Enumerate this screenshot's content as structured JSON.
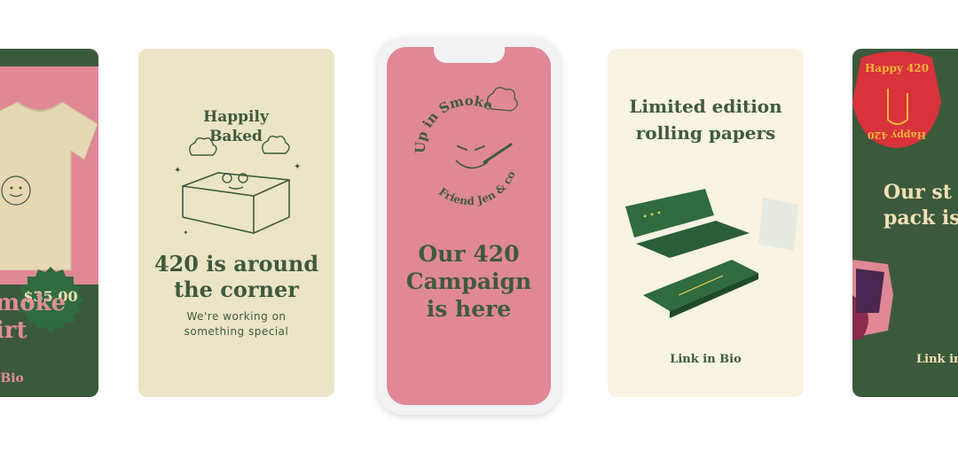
{
  "cards": [
    {
      "price": "$35.00",
      "title_lines": [
        "Smoke",
        "hirt"
      ],
      "link": "in Bio"
    },
    {
      "badge_text": "Happily Baked",
      "title_lines": [
        "420 is around",
        "the corner"
      ],
      "sub_lines": [
        "We're working on",
        "something special"
      ]
    },
    {
      "emblem_text": "Up in Smoke · Friend Jen & co",
      "title_lines": [
        "Our 420",
        "Campaign",
        "is here"
      ]
    },
    {
      "title_lines": [
        "Limited edition",
        "rolling papers"
      ],
      "link": "Link in Bio"
    },
    {
      "sticker_text": "Happy 420",
      "title_lines": [
        "Our st",
        "pack is"
      ],
      "link": "Link in"
    }
  ],
  "colors": {
    "forest_green": "#3b5a3d",
    "pink": "#e08896",
    "cream": "#ebe4c6",
    "light_cream": "#f8f4e1",
    "red": "#d8323a",
    "gold": "#f2b43a"
  }
}
